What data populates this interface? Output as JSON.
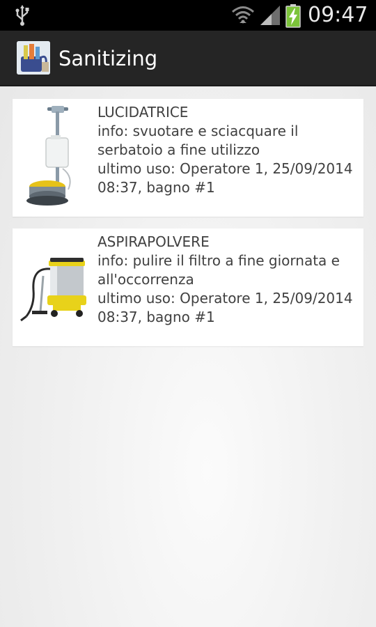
{
  "status_bar": {
    "time": "09:47",
    "icons": [
      "usb-icon",
      "wifi-icon",
      "signal-icon",
      "battery-charging-icon"
    ]
  },
  "action_bar": {
    "app_icon": "cleaning-supplies-icon",
    "title": "Sanitizing"
  },
  "items": [
    {
      "name": "LUCIDATRICE",
      "info": "info: svuotare e sciacquare il serbatoio a fine utilizzo",
      "last_use": "ultimo uso: Operatore 1, 25/09/2014 08:37, bagno #1",
      "image": "floor-polisher-image"
    },
    {
      "name": "ASPIRAPOLVERE",
      "info": "info: pulire il filtro a fine giornata e all'occorrenza",
      "last_use": "ultimo uso: Operatore 1, 25/09/2014 08:37, bagno #1",
      "image": "vacuum-cleaner-image"
    }
  ],
  "colors": {
    "status_bar": "#000000",
    "action_bar": "#252525",
    "card": "#ffffff",
    "text": "#404040",
    "accent_yellow": "#e8d21a",
    "battery_green": "#7cc43a"
  }
}
